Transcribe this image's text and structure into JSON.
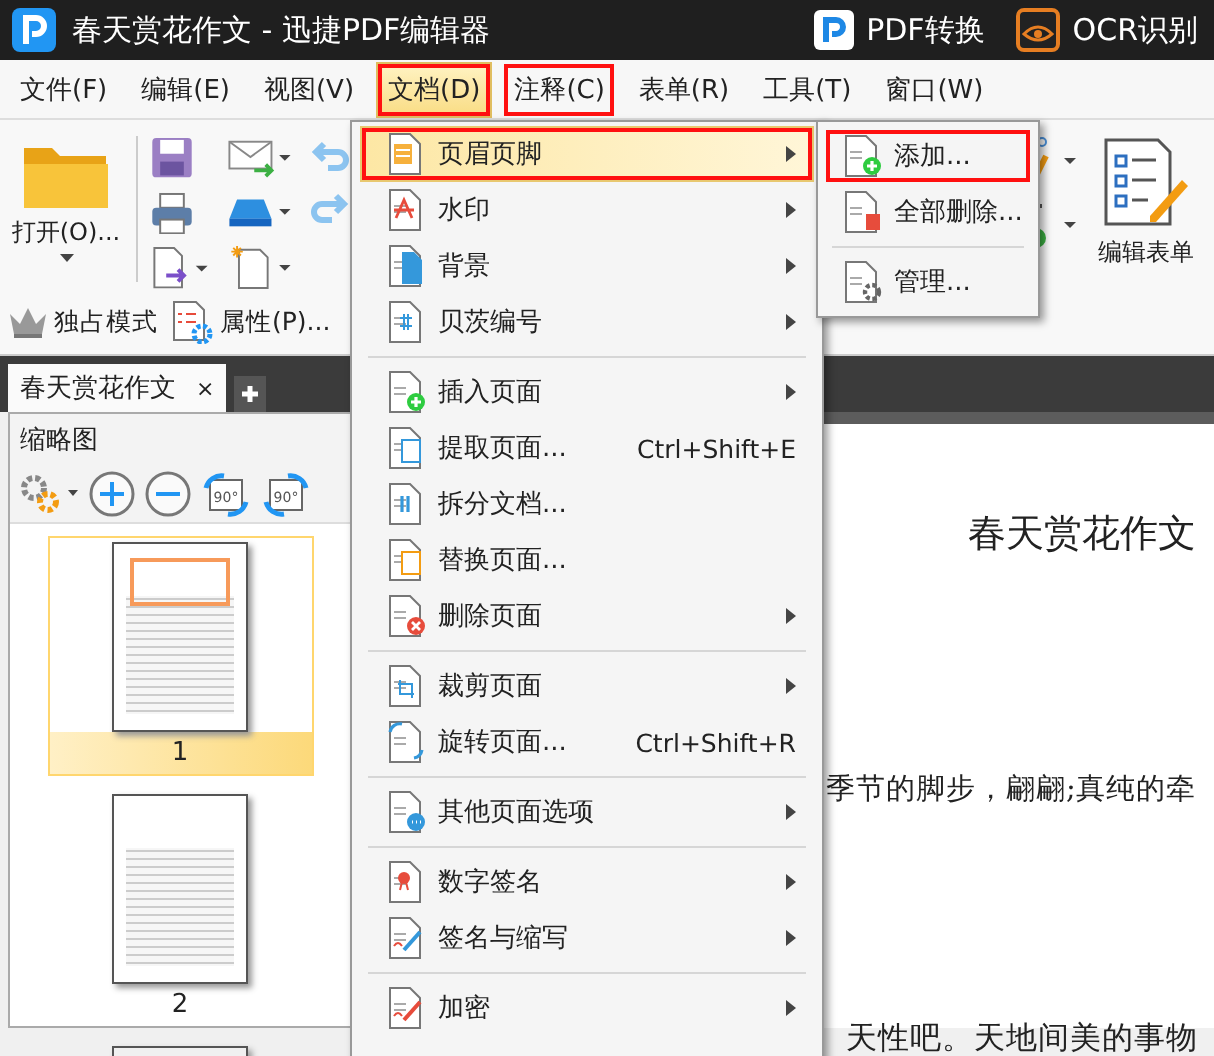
{
  "window": {
    "title": "春天赏花作文 - 迅捷PDF编辑器"
  },
  "title_actions": [
    {
      "label": "PDF转换",
      "kind": "pdf"
    },
    {
      "label": "OCR识别",
      "kind": "ocr"
    }
  ],
  "menu_bar": [
    {
      "label": "文件(F)",
      "selected": false,
      "framed": false
    },
    {
      "label": "编辑(E)",
      "selected": false,
      "framed": false
    },
    {
      "label": "视图(V)",
      "selected": false,
      "framed": false
    },
    {
      "label": "文档(D)",
      "selected": true,
      "framed": true
    },
    {
      "label": "注释(C)",
      "selected": false,
      "framed": true
    },
    {
      "label": "表单(R)",
      "selected": false,
      "framed": false
    },
    {
      "label": "工具(T)",
      "selected": false,
      "framed": false
    },
    {
      "label": "窗口(W)",
      "selected": false,
      "framed": false
    }
  ],
  "toolbar": {
    "open_label": "打开(O)...",
    "form_label": "编辑表单"
  },
  "toolbar_row2": [
    {
      "label": "独占模式",
      "kind": "crown"
    },
    {
      "label": "属性(P)...",
      "kind": "properties"
    }
  ],
  "tabs": [
    {
      "label": "春天赏花作文",
      "selected": true,
      "close": "×"
    }
  ],
  "thumbnails": {
    "title": "缩略图",
    "tools": [
      {
        "kind": "settings"
      },
      {
        "kind": "zoom-in"
      },
      {
        "kind": "zoom-out"
      },
      {
        "kind": "rotate-left",
        "label": "90°"
      },
      {
        "kind": "rotate-right",
        "label": "90°"
      }
    ],
    "pages": [
      {
        "label": "1",
        "selected": true,
        "highlight": true
      },
      {
        "label": "2",
        "selected": false,
        "highlight": false
      },
      {
        "selected": false
      }
    ]
  },
  "document": {
    "title": "春天赏花作文",
    "lines": [
      "季节的脚步，翩翩;真纯的牵",
      "天性吧。天地间美的事物"
    ]
  },
  "menu": {
    "items": [
      {
        "kind": "item",
        "label": "页眉页脚",
        "submenu": true,
        "selected": true,
        "framed": true
      },
      {
        "kind": "item",
        "label": "水印",
        "submenu": true,
        "selected": false,
        "framed": false
      },
      {
        "kind": "item",
        "label": "背景",
        "submenu": true,
        "selected": false,
        "framed": false
      },
      {
        "kind": "item",
        "label": "贝茨编号",
        "submenu": true,
        "selected": false,
        "framed": false
      },
      {
        "kind": "separator"
      },
      {
        "kind": "item",
        "label": "插入页面",
        "submenu": true,
        "selected": false,
        "framed": false
      },
      {
        "kind": "item",
        "label": "提取页面...",
        "shortcut": "Ctrl+Shift+E",
        "submenu": false,
        "selected": false,
        "framed": false
      },
      {
        "kind": "item",
        "label": "拆分文档...",
        "submenu": false,
        "selected": false,
        "framed": false
      },
      {
        "kind": "item",
        "label": "替换页面...",
        "submenu": false,
        "selected": false,
        "framed": false
      },
      {
        "kind": "item",
        "label": "删除页面",
        "submenu": true,
        "selected": false,
        "framed": false
      },
      {
        "kind": "separator"
      },
      {
        "kind": "item",
        "label": "裁剪页面",
        "submenu": true,
        "selected": false,
        "framed": false
      },
      {
        "kind": "item",
        "label": "旋转页面...",
        "shortcut": "Ctrl+Shift+R",
        "submenu": false,
        "selected": false,
        "framed": false
      },
      {
        "kind": "separator"
      },
      {
        "kind": "item",
        "label": "其他页面选项",
        "submenu": true,
        "selected": false,
        "framed": false
      },
      {
        "kind": "separator"
      },
      {
        "kind": "item",
        "label": "数字签名",
        "submenu": true,
        "selected": false,
        "framed": false
      },
      {
        "kind": "item",
        "label": "签名与缩写",
        "submenu": true,
        "selected": false,
        "framed": false
      },
      {
        "kind": "separator"
      },
      {
        "kind": "item",
        "label": "加密",
        "submenu": true,
        "selected": false,
        "framed": false
      }
    ]
  },
  "submenu": {
    "items": [
      {
        "kind": "item",
        "label": "添加...",
        "framed": true
      },
      {
        "kind": "item",
        "label": "全部删除...",
        "framed": false
      },
      {
        "kind": "separator"
      },
      {
        "kind": "item",
        "label": "管理...",
        "framed": false
      }
    ]
  }
}
